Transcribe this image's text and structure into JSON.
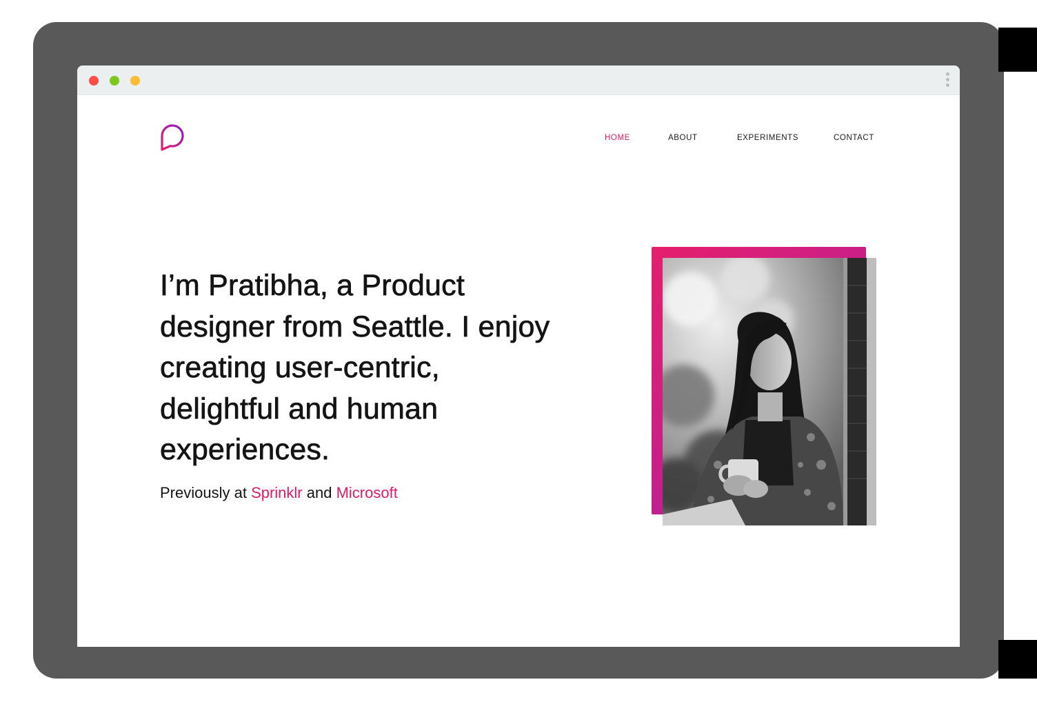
{
  "nav": {
    "home": "HOME",
    "about": "ABOUT",
    "experiments": "EXPERIMENTS",
    "contact": "CONTACT"
  },
  "hero": {
    "lines": [
      "I’m Pratibha, a Product",
      "designer from Seattle. I enjoy",
      "creating user-centric,",
      "delightful and human",
      "experiences."
    ],
    "previously_prefix": "Previously at ",
    "company_1": "Sprinklr",
    "connector": " and ",
    "company_2": "Microsoft"
  },
  "icons": {
    "logo": "speech-bubble-p-logo",
    "kebab": "vertical-ellipsis-icon"
  },
  "colors": {
    "accent": "#d81b69",
    "accent_purple": "#9b1fb3",
    "dot_red": "#ff4d4a",
    "dot_green": "#7ec81c",
    "dot_yellow": "#ffbb33",
    "text": "#141414"
  }
}
